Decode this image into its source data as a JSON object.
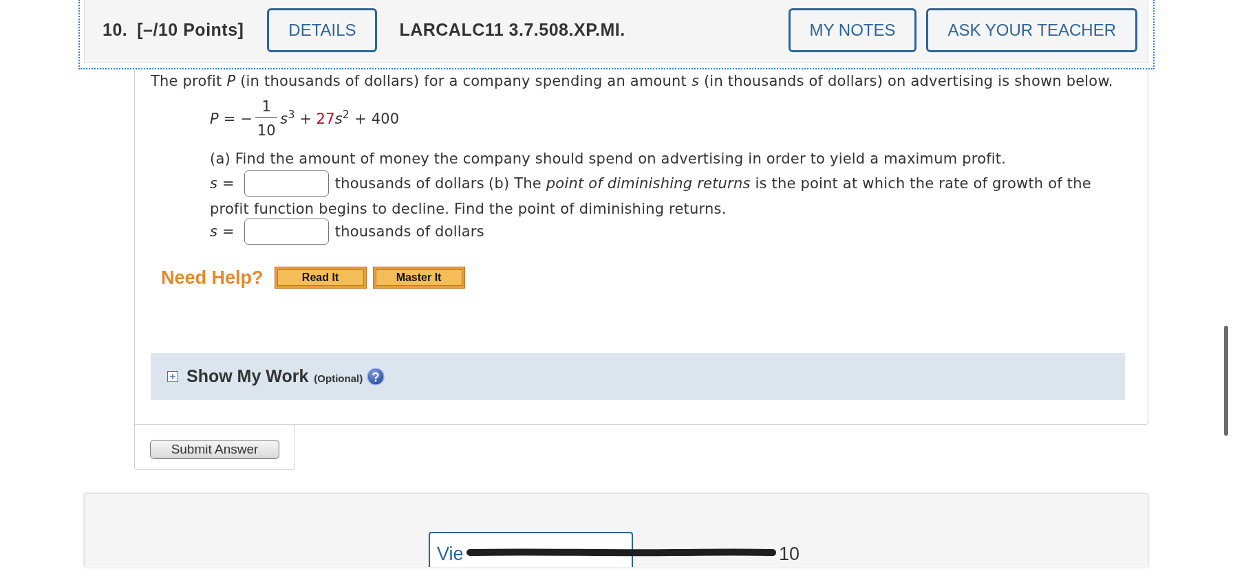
{
  "header": {
    "number": "10.",
    "points": "[–/10 Points]",
    "details_button": "DETAILS",
    "problem_code": "LARCALC11 3.7.508.XP.MI.",
    "buttons": [
      "MY NOTES",
      "ASK YOUR TEACHER"
    ]
  },
  "question": {
    "intro": "The profit *P* (in thousands of dollars) for a company spending an amount *s* (in thousands of dollars) on advertising is shown below.",
    "formula": [
      {
        "kind": "text",
        "text": "*P* = −"
      },
      {
        "kind": "fraction",
        "numerator": "1",
        "denominator": "10"
      },
      {
        "kind": "text",
        "text": "*s*$^{3}$ +"
      },
      {
        "kind": "highlight",
        "text": "27"
      },
      {
        "kind": "text",
        "text": "*s*$^{2}$ + 400"
      }
    ],
    "body": [
      {
        "kind": "text",
        "text": "(a) Find the amount of money the company should spend on advertising in order to yield a maximum profit."
      },
      {
        "kind": "answer",
        "label": "*s* =",
        "unit": "thousands of dollars",
        "trailing": "(b) The *point of diminishing returns* is the point at which the rate of growth of the"
      },
      {
        "kind": "text",
        "text": "profit function begins to decline. Find the point of diminishing returns."
      },
      {
        "kind": "answer",
        "label": "*s* =",
        "unit": "thousands of dollars"
      }
    ]
  },
  "need_help": {
    "title": "Need Help?",
    "buttons": [
      "Read It",
      "Master It"
    ]
  },
  "show_my_work": {
    "title": "Show My Work",
    "note": "(Optional)",
    "expanded": false
  },
  "submit_button": "Submit Answer",
  "navigation": {
    "button": "Vie",
    "counter": "10"
  }
}
